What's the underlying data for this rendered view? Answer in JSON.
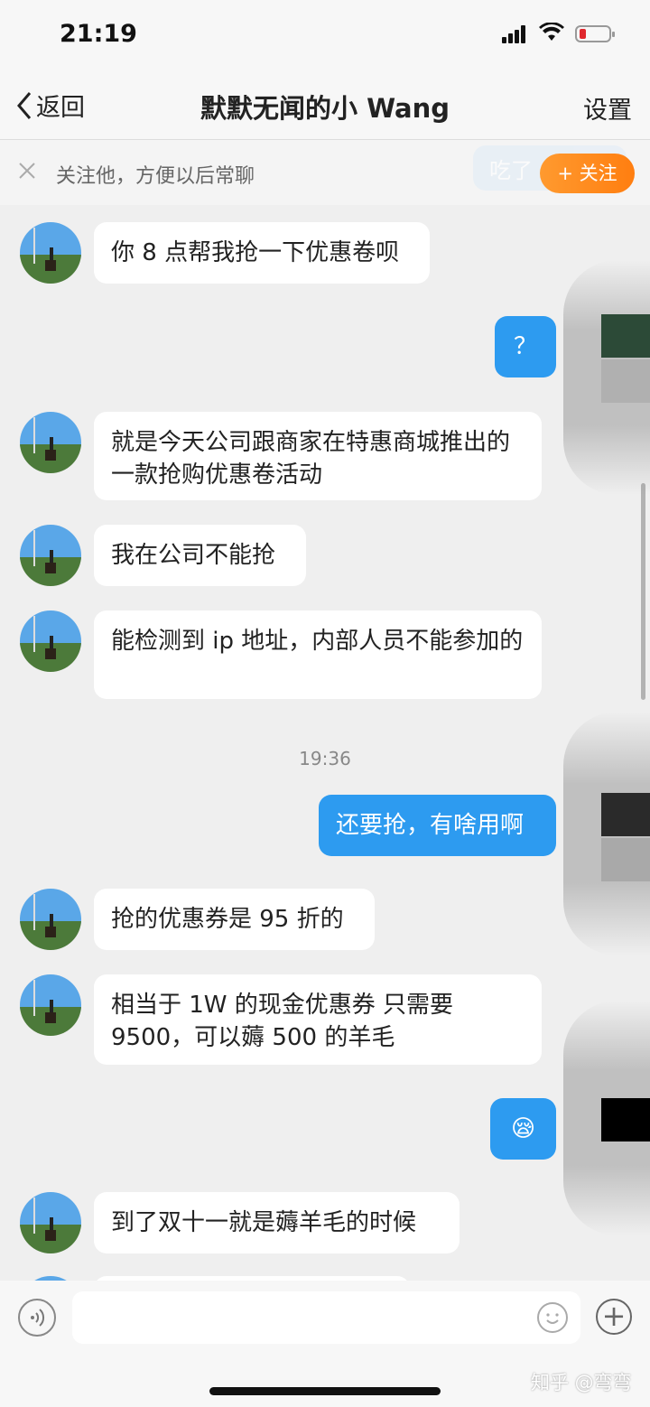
{
  "status": {
    "time": "21:19"
  },
  "nav": {
    "back_label": "返回",
    "title": "默默无闻的小 Wang",
    "settings_label": "设置"
  },
  "follow": {
    "text": "关注他，方便以后常聊",
    "ghost_text": "吃了",
    "button": "+ 关注"
  },
  "messages": [
    {
      "from": "them",
      "text": "你 8 点帮我抢一下优惠卷呗"
    },
    {
      "from": "me",
      "text": "？"
    },
    {
      "from": "them",
      "text": "就是今天公司跟商家在特惠商城推出的一款抢购优惠卷活动"
    },
    {
      "from": "them",
      "text": "我在公司不能抢"
    },
    {
      "from": "them",
      "text": "能检测到 ip 地址，内部人员不能参加的"
    },
    {
      "from": "me",
      "text": "还要抢，有啥用啊"
    },
    {
      "from": "them",
      "text": "抢的优惠券是 95 折的"
    },
    {
      "from": "them",
      "text": "相当于 1W 的现金优惠券 只需要 9500，可以薅 500 的羊毛"
    },
    {
      "from": "me",
      "text": "😪"
    },
    {
      "from": "them",
      "text": "到了双十一就是薅羊毛的时候"
    }
  ],
  "timestamp": "19:36",
  "watermark": "知乎 @弯弯",
  "colors": {
    "out_bubble": "#2d9bf0",
    "follow_btn": "#ff8a1f",
    "background": "#efefef"
  }
}
